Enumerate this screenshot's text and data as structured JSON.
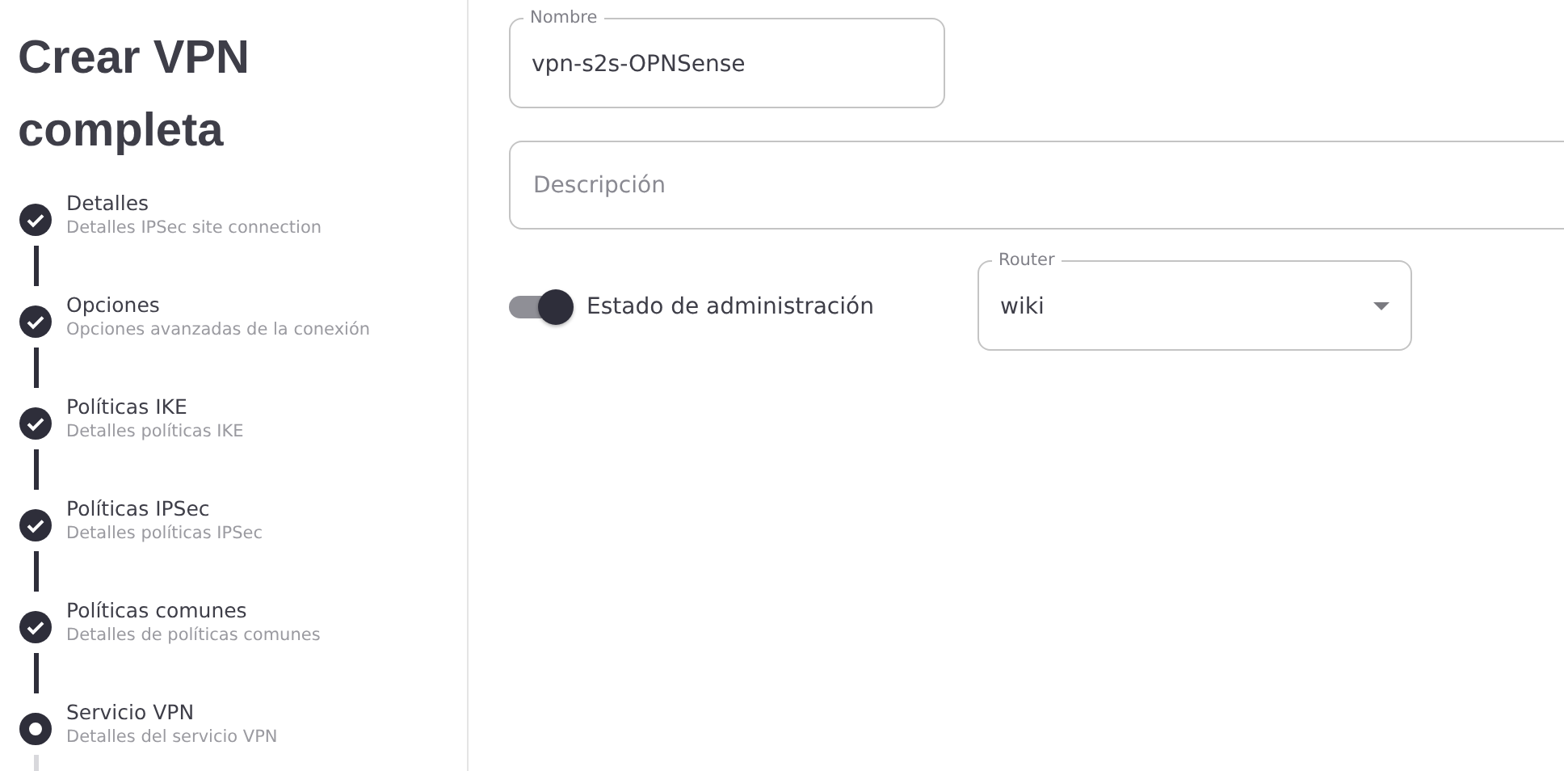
{
  "title": "Crear VPN completa",
  "steps": [
    {
      "label": "Detalles",
      "description": "Detalles IPSec site connection",
      "completed": true
    },
    {
      "label": "Opciones",
      "description": "Opciones avanzadas de la conexión",
      "completed": true
    },
    {
      "label": "Políticas IKE",
      "description": "Detalles políticas IKE",
      "completed": true
    },
    {
      "label": "Políticas IPSec",
      "description": "Detalles políticas IPSec",
      "completed": true
    },
    {
      "label": "Políticas comunes",
      "description": "Detalles de políticas comunes",
      "completed": true
    },
    {
      "label": "Servicio VPN",
      "description": "Detalles del servicio VPN",
      "completed": false
    }
  ],
  "form": {
    "name_field": {
      "label": "Nombre",
      "value": "vpn-s2s-OPNSense"
    },
    "description_field": {
      "placeholder": "Descripción"
    },
    "admin_state": {
      "label": "Estado de administración",
      "on": true
    },
    "router_select": {
      "label": "Router",
      "value": "wiki"
    }
  }
}
